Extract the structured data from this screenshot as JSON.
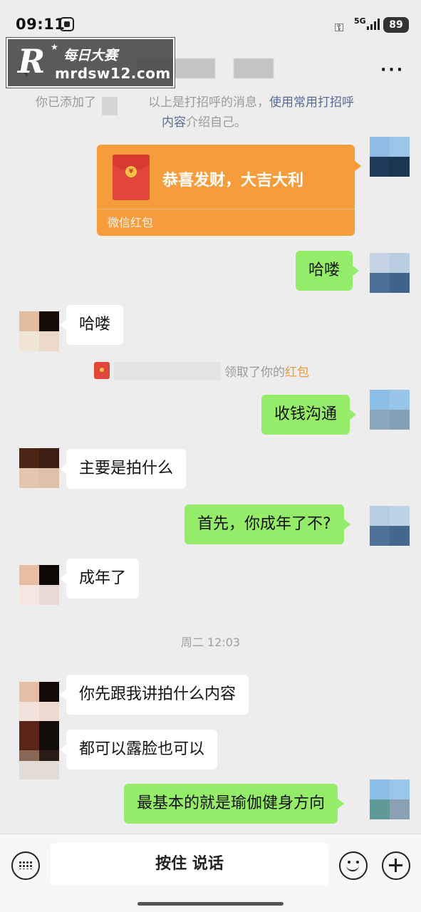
{
  "status_bar": {
    "time": "09:11",
    "network": "5G",
    "battery": "89"
  },
  "watermark": {
    "logo": "R",
    "title": "每日大赛",
    "url": "mrdsw12.com"
  },
  "header": {
    "back_icon": "chevron-left-icon",
    "more_icon": "more-dots-icon"
  },
  "system_notice": {
    "added_text": "你已添加了",
    "greeting_text": "以上是打招呼的消息，",
    "link_text_1": "使用常用打招呼",
    "link_text_2": "内容",
    "tail_text": "介绍自己。"
  },
  "red_packet": {
    "title": "恭喜发财，大吉大利",
    "caption": "微信红包",
    "coin_symbol": "¥"
  },
  "red_packet_notice": {
    "text": "领取了你的",
    "highlight": "红包"
  },
  "messages": [
    {
      "side": "out",
      "text": "哈喽"
    },
    {
      "side": "in",
      "text": "哈喽"
    },
    {
      "side": "out",
      "text": "收钱沟通"
    },
    {
      "side": "in",
      "text": "主要是拍什么"
    },
    {
      "side": "out",
      "text": "首先，你成年了不?"
    },
    {
      "side": "in",
      "text": "成年了"
    },
    {
      "side": "in",
      "text": "你先跟我讲拍什么内容"
    },
    {
      "side": "in",
      "text": "都可以露脸也可以"
    },
    {
      "side": "out",
      "text": "最基本的就是瑜伽健身方向"
    }
  ],
  "timestamp": "周二 12:03",
  "input_bar": {
    "hold_to_talk": "按住 说话",
    "keyboard_icon": "keyboard-icon",
    "emoji_icon": "emoji-icon",
    "plus_icon": "plus-icon"
  },
  "colors": {
    "background": "#ededed",
    "outgoing_bubble": "#95ec69",
    "incoming_bubble": "#ffffff",
    "red_packet": "#f79c3a",
    "link": "#576b95"
  }
}
